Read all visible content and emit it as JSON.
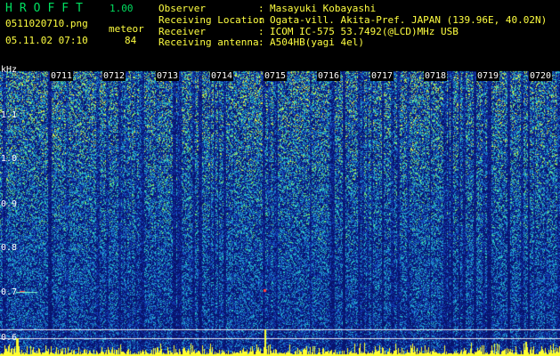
{
  "app": {
    "title": "HROFFT",
    "version": "1.00"
  },
  "file": {
    "name": "0511020710.png",
    "datetime": "05.11.02 07:10",
    "mode": "meteor",
    "count": "84"
  },
  "info": [
    {
      "key": "Observer",
      "value": "Masayuki Kobayashi"
    },
    {
      "key": "Receiving Location",
      "value": "Ogata-vill. Akita-Pref. JAPAN (139.96E, 40.02N)"
    },
    {
      "key": "Receiver",
      "value": "ICOM IC-575 53.7492(@LCD)MHz USB"
    },
    {
      "key": "Receiving antenna",
      "value": "A504HB(yagi 4el)"
    }
  ],
  "spectrogram": {
    "y_unit": "kHz",
    "y_ticks": [
      "1.1",
      "1.0",
      "0.9",
      "0.8",
      "0.7",
      "0.6"
    ],
    "time_labels": [
      "0711",
      "0712",
      "0713",
      "0714",
      "0715",
      "0716",
      "0717",
      "0718",
      "0719",
      "0720"
    ],
    "colors": {
      "background": "#0b1e7a",
      "low": "#1a3fb0",
      "mid": "#22c4d8",
      "high": "#7cf06a",
      "hot": "#ffff30",
      "grid": "#ffffff"
    }
  }
}
